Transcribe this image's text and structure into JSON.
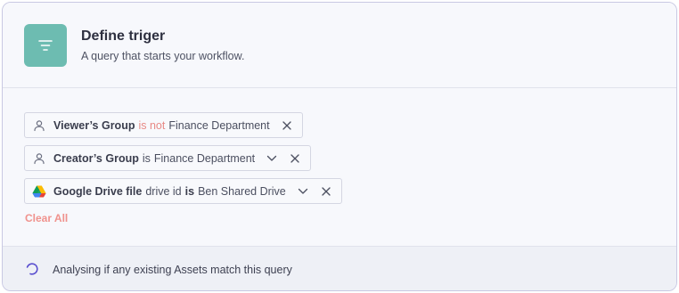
{
  "header": {
    "icon": "filter-icon",
    "title": "Define triger",
    "subtitle": "A query that starts your workflow."
  },
  "filters": [
    {
      "icon": "user-icon",
      "field": "Viewer’s Group",
      "operator": "is not",
      "value": "Finance Department",
      "has_dropdown": false
    },
    {
      "icon": "user-icon",
      "field": "Creator’s Group",
      "operator": "is",
      "value": "Finance Department",
      "has_dropdown": true
    },
    {
      "icon": "google-drive-icon",
      "field": "Google Drive file",
      "mid": "drive id",
      "operator": "is",
      "value": "Ben Shared Drive",
      "has_dropdown": true
    }
  ],
  "clear_all_label": "Clear All",
  "footer": {
    "status_text": "Analysing if any existing Assets match this query"
  },
  "colors": {
    "accent": "#6dbcb1",
    "negative": "#e88a86",
    "clear": "#f0928d",
    "spinner": "#5a4fcf"
  }
}
